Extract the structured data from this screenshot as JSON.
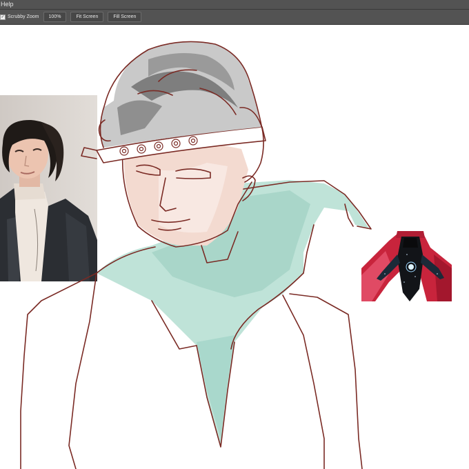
{
  "menubar": {
    "help_label": "Help"
  },
  "options": {
    "scrubby_zoom_label": "Scrubby Zoom",
    "scrubby_zoom_checked": true,
    "zoom_button": "100%",
    "fit_screen_button": "Fit Screen",
    "fill_screen_button": "Fill Screen"
  },
  "canvas": {
    "background": "#ffffff",
    "line_color": "#7a2a24",
    "scarf_color": "#a9d8cc",
    "skin_color": "#f3d9cf",
    "hair_color": "#8c8c8c"
  }
}
